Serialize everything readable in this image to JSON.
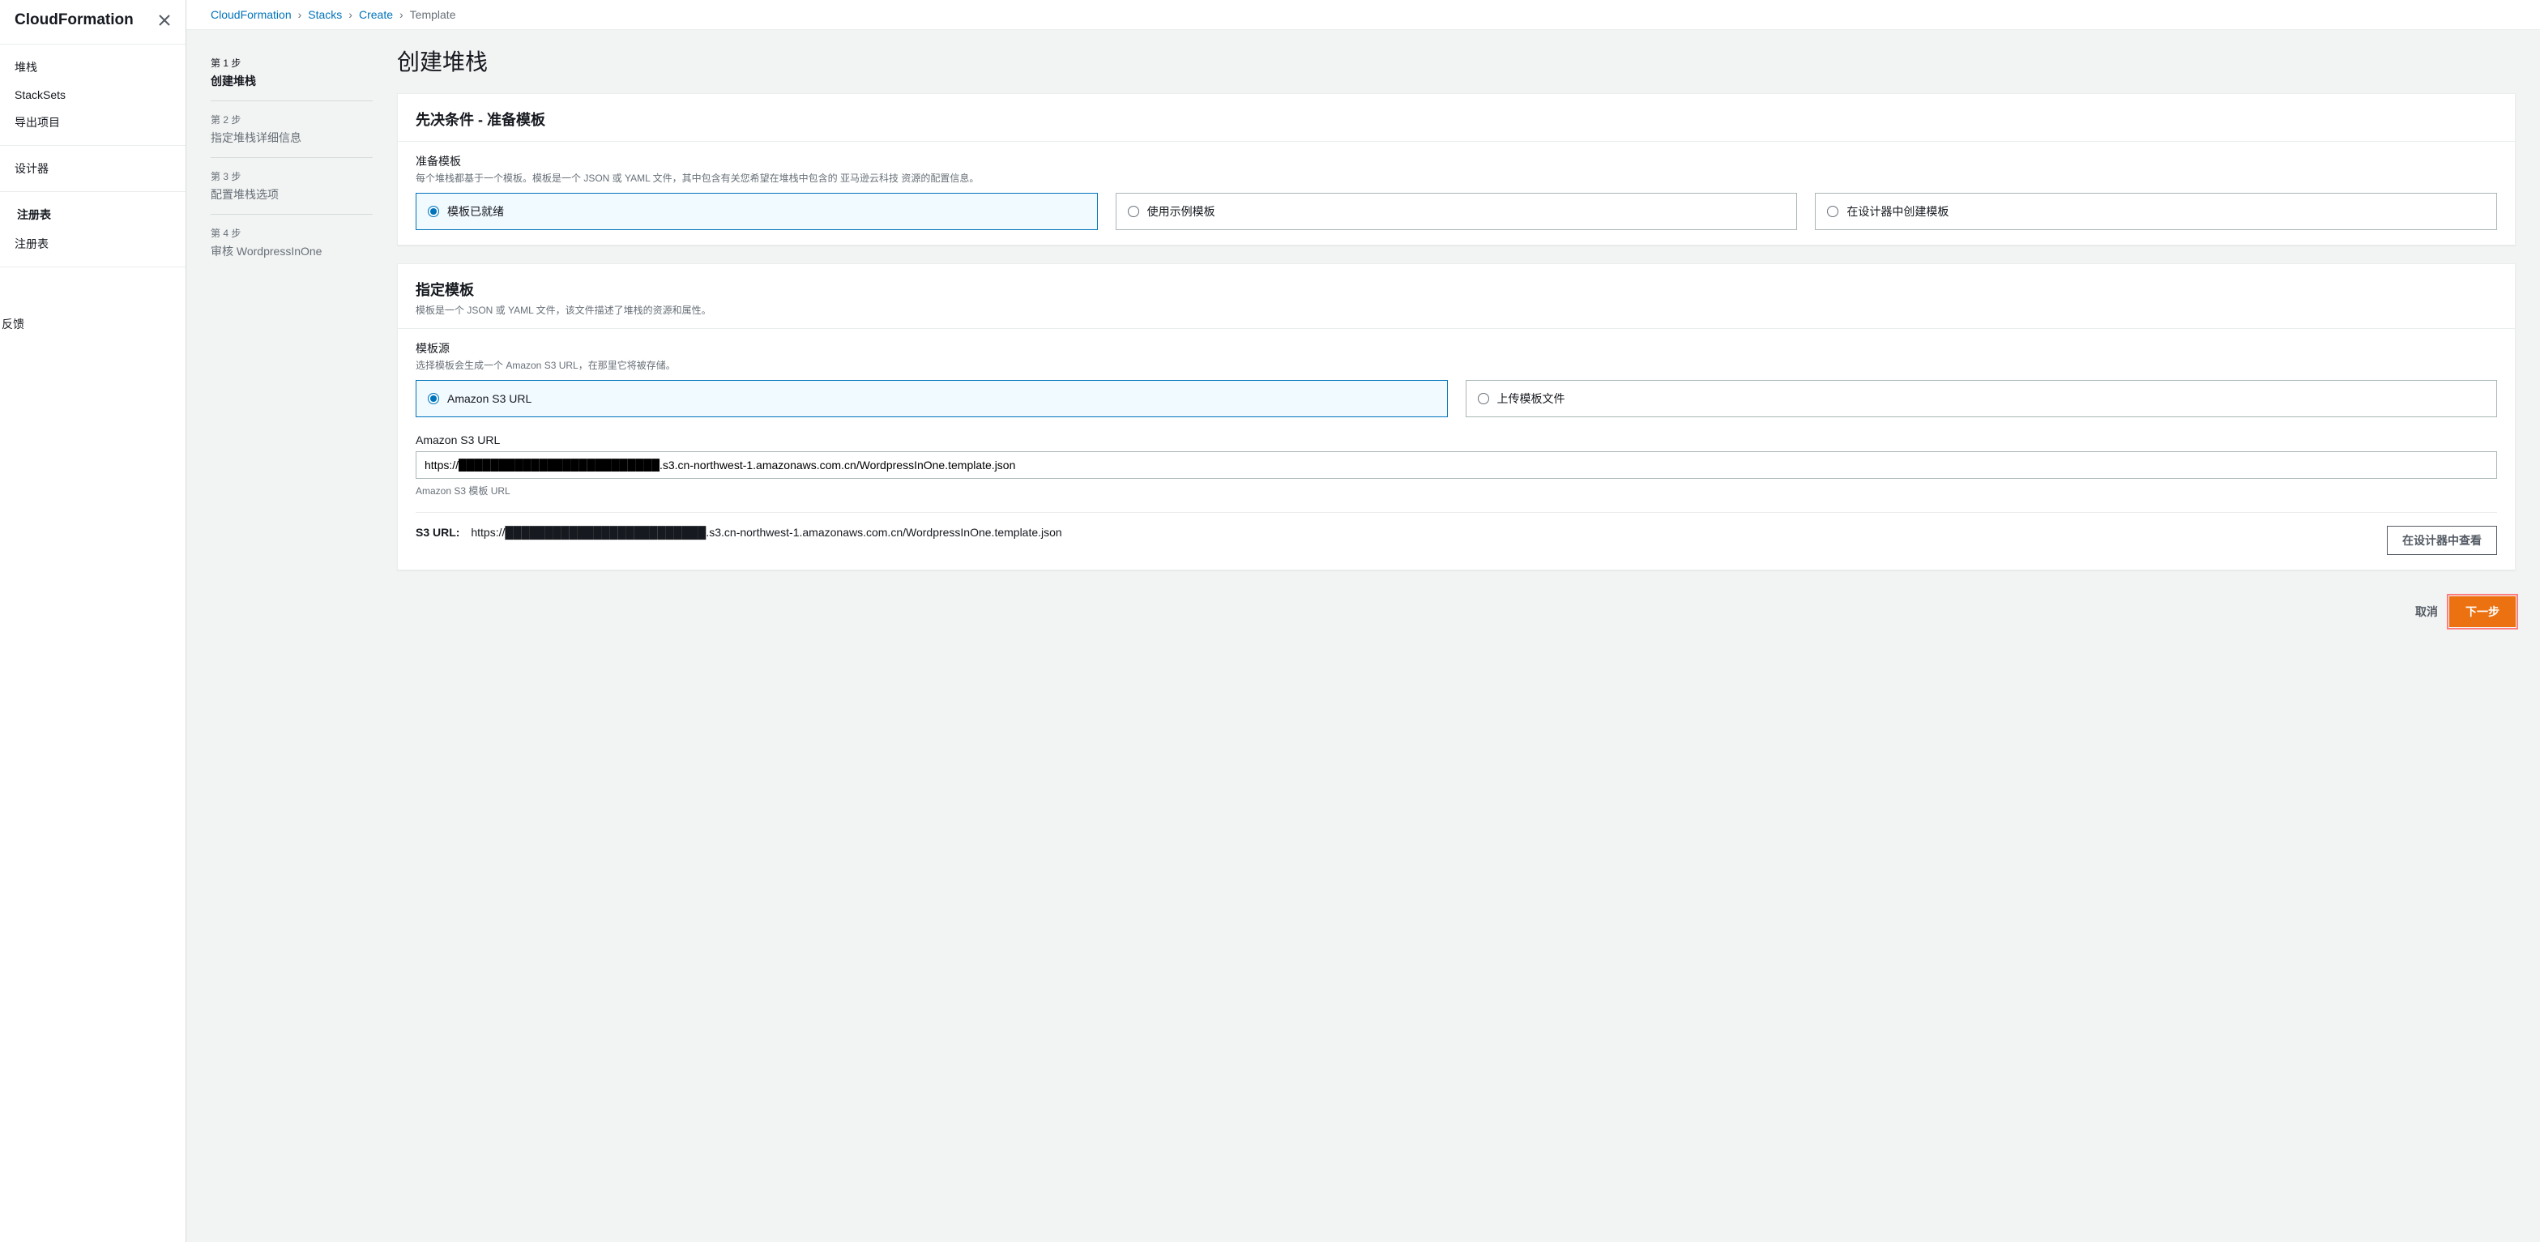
{
  "sidebar": {
    "title": "CloudFormation",
    "groups": [
      [
        "堆栈",
        "StackSets",
        "导出项目"
      ],
      [
        "设计器"
      ],
      [
        "注册表",
        "注册表"
      ]
    ],
    "feedback": "反馈"
  },
  "breadcrumbs": {
    "items": [
      "CloudFormation",
      "Stacks",
      "Create"
    ],
    "current": "Template"
  },
  "steps": [
    {
      "num": "第 1 步",
      "label": "创建堆栈"
    },
    {
      "num": "第 2 步",
      "label": "指定堆栈详细信息"
    },
    {
      "num": "第 3 步",
      "label": "配置堆栈选项"
    },
    {
      "num": "第 4 步",
      "label": "审核 WordpressInOne"
    }
  ],
  "page_title": "创建堆栈",
  "cards": {
    "prereq": {
      "title": "先决条件 - 准备模板",
      "field_label": "准备模板",
      "field_desc": "每个堆栈都基于一个模板。模板是一个 JSON 或 YAML 文件，其中包含有关您希望在堆栈中包含的 亚马逊云科技 资源的配置信息。",
      "options": [
        "模板已就绪",
        "使用示例模板",
        "在设计器中创建模板"
      ]
    },
    "template": {
      "title": "指定模板",
      "subtitle": "模板是一个 JSON 或 YAML 文件，该文件描述了堆栈的资源和属性。",
      "source_label": "模板源",
      "source_desc": "选择模板会生成一个 Amazon S3 URL，在那里它将被存储。",
      "source_options": [
        "Amazon S3 URL",
        "上传模板文件"
      ],
      "url_label": "Amazon S3 URL",
      "url_value": "https://█████████████████████████.s3.cn-northwest-1.amazonaws.com.cn/WordpressInOne.template.json",
      "url_hint": "Amazon S3 模板 URL",
      "s3_display_label": "S3 URL:",
      "s3_display_value": "https://█████████████████████████.s3.cn-northwest-1.amazonaws.com.cn/WordpressInOne.template.json",
      "view_designer": "在设计器中查看"
    }
  },
  "footer": {
    "cancel": "取消",
    "next": "下一步"
  }
}
